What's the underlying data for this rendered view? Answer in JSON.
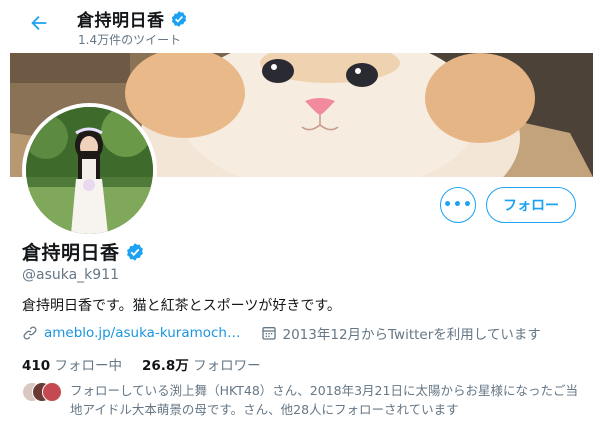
{
  "header": {
    "name": "倉持明日香",
    "tweet_count": "1.4万件のツイート"
  },
  "profile": {
    "name": "倉持明日香",
    "handle": "@asuka_k911",
    "bio": "倉持明日香です。猫と紅茶とスポーツが好きです。",
    "website": "ameblo.jp/asuka-kuramoch…",
    "joined": "2013年12月からTwitterを利用しています",
    "following_count": "410",
    "following_label": "フォロー中",
    "followers_count": "26.8万",
    "followers_label": "フォロワー",
    "followed_by_text": "フォローしている渕上舞（HKT48）さん、2018年3月21日に太陽からお星様になったご当地アイドル大本萌景の母です。さん、他28人にフォローされています"
  },
  "buttons": {
    "more": "•••",
    "follow": "フォロー"
  },
  "icons": {
    "back": "arrow-left-icon",
    "verified": "verified-badge-icon",
    "link": "link-icon",
    "calendar": "calendar-icon",
    "more": "more-dots-icon"
  },
  "colors": {
    "accent": "#1da1f2",
    "link": "#1b95e0",
    "secondary_text": "#657786"
  }
}
